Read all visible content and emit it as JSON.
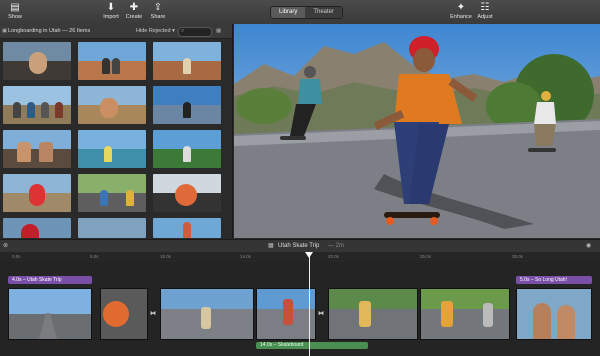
{
  "toolbar": {
    "show_label": "Show",
    "import_label": "Import",
    "create_label": "Create",
    "share_label": "Share",
    "tabs": [
      "Library",
      "Theater"
    ],
    "active_tab": "Library",
    "enhance_label": "Enhance",
    "adjust_label": "Adjust"
  },
  "browser": {
    "event_title": "Longboarding in Utah — 26 Items",
    "filter": "Hide Rejected"
  },
  "timeline": {
    "project_title": "Utah Skate Trip",
    "duration": "— 2m",
    "ticks": [
      "0.0s",
      "5.0s",
      "10.0s",
      "14.0s",
      "20.0s",
      "25.0s",
      "30.0s"
    ],
    "titles": [
      {
        "label": "4.0s – Utah Skate Trip"
      },
      {
        "label": "5.0s – So Long Utah!"
      }
    ],
    "audio": {
      "label": "14.0s – Skateboard"
    }
  },
  "colors": {
    "title_purple": "#7a4fa8",
    "audio_green": "#4a8f52",
    "accent": "#e74c3c"
  }
}
